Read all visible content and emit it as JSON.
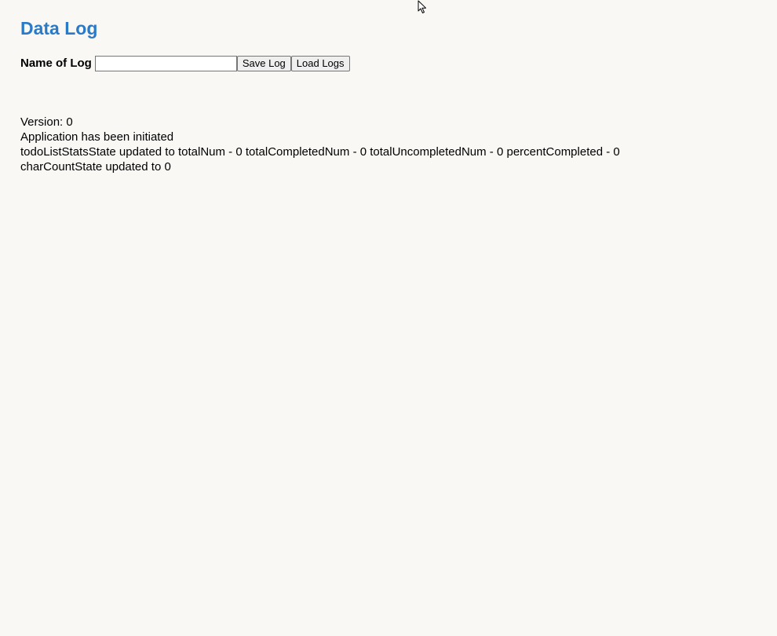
{
  "header": {
    "title": "Data Log"
  },
  "form": {
    "label": "Name of Log",
    "input_value": "",
    "save_label": "Save Log",
    "load_label": "Load Logs"
  },
  "log": {
    "lines": [
      "Version: 0",
      "Application has been initiated",
      "todoListStatsState updated to totalNum - 0 totalCompletedNum - 0 totalUncompletedNum - 0 percentCompleted - 0",
      "charCountState updated to 0"
    ]
  },
  "colors": {
    "background": "#f9f8f5",
    "title": "#2a7ac6"
  },
  "icons": {
    "cursor": "mouse-pointer-icon"
  }
}
